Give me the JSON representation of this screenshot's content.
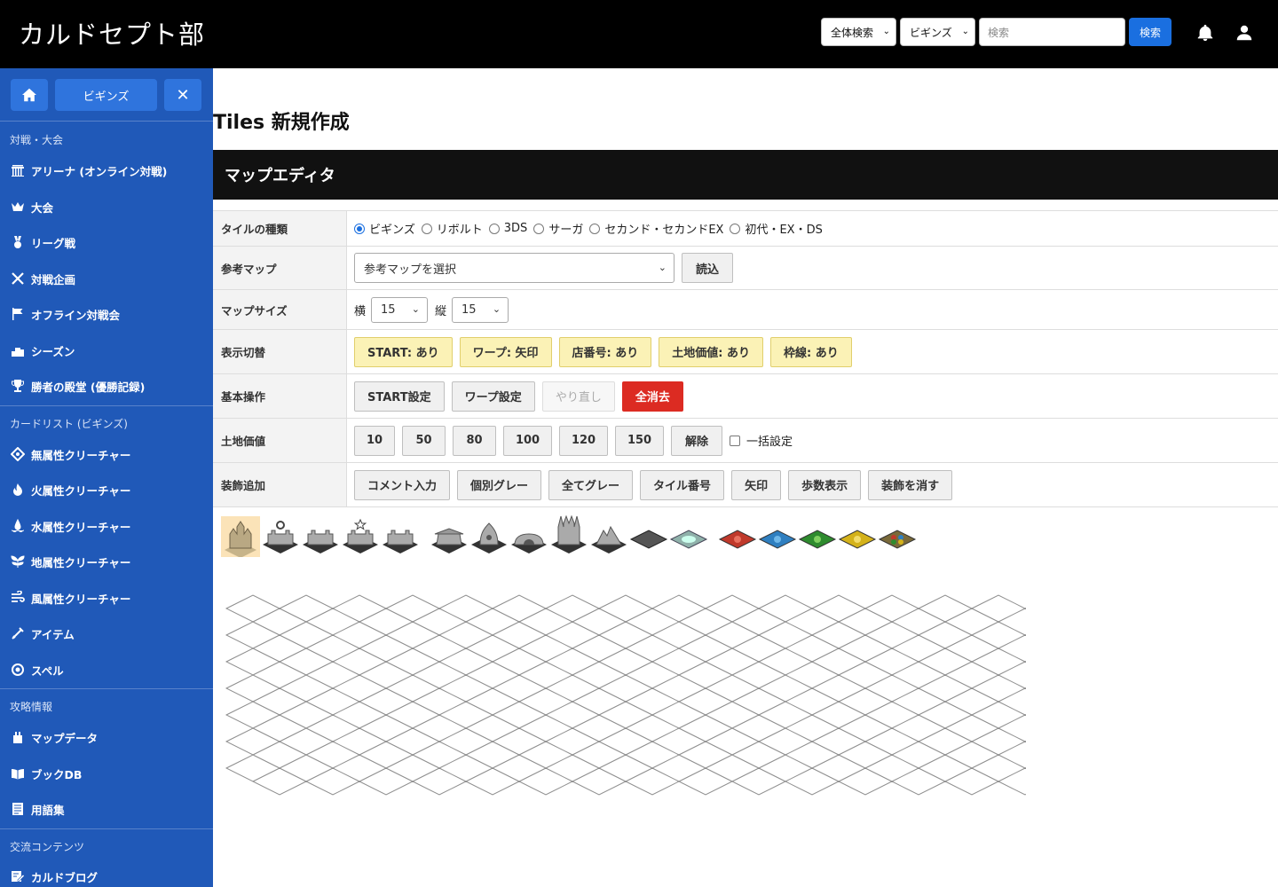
{
  "header": {
    "site_title": "カルドセプト部",
    "scope_select": "全体検索",
    "edition_select": "ビギンズ",
    "search_placeholder": "検索",
    "search_button": "検索"
  },
  "sidebar": {
    "home_label": "",
    "edition_label": "ビギンズ",
    "sections": [
      {
        "title": "対戦・大会",
        "items": [
          {
            "label": "アリーナ (オンライン対戦)",
            "icon": "colosseum-icon"
          },
          {
            "label": "大会",
            "icon": "crown-icon"
          },
          {
            "label": "リーグ戦",
            "icon": "medal-icon"
          },
          {
            "label": "対戦企画",
            "icon": "crossed-swords-icon"
          },
          {
            "label": "オフライン対戦会",
            "icon": "flag-icon"
          },
          {
            "label": "シーズン",
            "icon": "podium-icon"
          },
          {
            "label": "勝者の殿堂 (優勝記録)",
            "icon": "trophy-icon"
          }
        ]
      },
      {
        "title": "カードリスト (ビギンズ)",
        "items": [
          {
            "label": "無属性クリーチャー",
            "icon": "neutral-element-icon"
          },
          {
            "label": "火属性クリーチャー",
            "icon": "fire-element-icon"
          },
          {
            "label": "水属性クリーチャー",
            "icon": "water-element-icon"
          },
          {
            "label": "地属性クリーチャー",
            "icon": "earth-element-icon"
          },
          {
            "label": "風属性クリーチャー",
            "icon": "wind-element-icon"
          },
          {
            "label": "アイテム",
            "icon": "item-icon"
          },
          {
            "label": "スペル",
            "icon": "spell-icon"
          }
        ]
      },
      {
        "title": "攻略情報",
        "items": [
          {
            "label": "マップデータ",
            "icon": "map-icon"
          },
          {
            "label": "ブックDB",
            "icon": "book-icon"
          },
          {
            "label": "用語集",
            "icon": "glossary-icon"
          }
        ]
      },
      {
        "title": "交流コンテンツ",
        "items": [
          {
            "label": "カルドブログ",
            "icon": "blog-icon"
          }
        ]
      }
    ]
  },
  "main": {
    "page_title": "Tiles 新規作成",
    "section_title": "マップエディタ",
    "rows": {
      "tile_type": {
        "label": "タイルの種類",
        "options": [
          "ビギンズ",
          "リボルト",
          "3DS",
          "サーガ",
          "セカンド・セカンドEX",
          "初代・EX・DS"
        ],
        "selected": "ビギンズ"
      },
      "reference_map": {
        "label": "参考マップ",
        "select": "参考マップを選択",
        "load_button": "読込"
      },
      "map_size": {
        "label": "マップサイズ",
        "width_label": "横",
        "width_value": "15",
        "height_label": "縦",
        "height_value": "15"
      },
      "display_toggle": {
        "label": "表示切替",
        "buttons": [
          "START: あり",
          "ワープ: 矢印",
          "店番号: あり",
          "土地価値: あり",
          "枠線: あり"
        ]
      },
      "basic_ops": {
        "label": "基本操作",
        "buttons": [
          "START設定",
          "ワープ設定",
          "やり直し",
          "全消去"
        ]
      },
      "land_value": {
        "label": "土地価値",
        "buttons": [
          "10",
          "50",
          "80",
          "100",
          "120",
          "150",
          "解除"
        ],
        "bulk_label": "一括設定"
      },
      "decoration": {
        "label": "装飾追加",
        "buttons": [
          "コメント入力",
          "個別グレー",
          "全てグレー",
          "タイル番号",
          "矢印",
          "歩数表示",
          "装飾を消す"
        ]
      }
    }
  },
  "colors": {
    "header_bg": "#000000",
    "sidebar_bg": "#2059b8",
    "accent_blue": "#1a6fe0",
    "toggle_yellow": "#fbf2b6",
    "danger_red": "#dc2b22"
  }
}
